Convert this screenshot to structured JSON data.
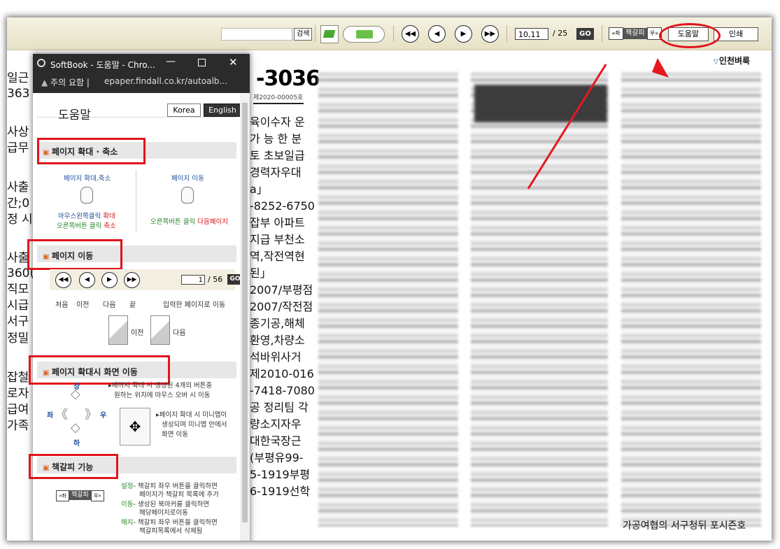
{
  "toolbar": {
    "search_placeholder": "",
    "search_label": "검색",
    "page_value": "10,11",
    "page_total": "/ 25",
    "go_label": "GO",
    "bookmark_left": "«좌",
    "bookmark_label": "책갈피",
    "bookmark_right": "우»",
    "help_label": "도움말",
    "print_label": "인쇄",
    "nav": [
      "◀◀",
      "◀",
      "▶",
      "▶▶"
    ]
  },
  "region_label": "인천벼룩",
  "newspaper": {
    "big_number": "-3036",
    "registration": "제2020-00005호",
    "left_fragments": [
      "일근",
      "363",
      "사상",
      "급무",
      "사출",
      "간;0",
      "정 시",
      "사출",
      "360(",
      "직모",
      "시급",
      "서구",
      "정밀",
      "잡철",
      "로자",
      "급여",
      "가족"
    ],
    "mid_lines": [
      "육이수자 운",
      "가 능 한 분",
      "토 초보일급",
      "경력자우대",
      "a」",
      "-8252-6750",
      "잡부 아파트",
      "지급 부천소",
      "역,작전역현",
      "된」",
      "2007/부평점",
      "2007/작전점",
      "종기공,해체",
      "환영,차량소",
      "석바위사거",
      "제2010-016",
      "-7418-7080",
      "공 정리팀 각",
      "량소지자우",
      "대한국장근",
      "(부평유99-",
      "5-1919부평",
      "6-1919선학"
    ],
    "bottom_right": "가공여협의 서구청뒤 포시즌호"
  },
  "popup": {
    "window_title": "SoftBook - 도움말 - Chro...",
    "warning_text": "주의 요함",
    "url": "epaper.findall.co.kr/autoalb...",
    "help_title": "도움말",
    "lang_korea": "Korea",
    "lang_english": "English",
    "sections": {
      "zoom": {
        "title": "페이지 확대 · 축소",
        "zoom_label": "페이지 확대,축소",
        "move_label": "페이지 이동",
        "left_click": "마우스왼쪽클릭",
        "zoom_in": "확대",
        "right_click": "오른쪽버튼 클릭",
        "zoom_out": "축소",
        "right_click2": "오른쪽버튼 클릭",
        "next_page": "다음페이지"
      },
      "nav": {
        "title": "페이지 이동",
        "page_value": "1",
        "page_total": "/ 56",
        "go": "GO",
        "labels": [
          "처음",
          "이전",
          "다음",
          "끝"
        ],
        "input_hint": "입력한 페이지로 이동",
        "prev": "이전",
        "next": "다음"
      },
      "zoom_move": {
        "title": "페이지 확대시 화면 이동",
        "desc1a": "▸페이지 확대 시 생성된 4개의 버튼중",
        "desc1b": "원하는 위치에 마우스 오버 시 이동",
        "desc2a": "▸페이지 확대 시 미니맵이",
        "desc2b": "생성되며 미니맵 안에서",
        "desc2c": "화면 이동",
        "up": "상",
        "left": "좌",
        "right": "우",
        "down": "하"
      },
      "bookmark": {
        "title": "책갈피 기능",
        "set_key": "설정",
        "set_a": "- 책갈피 좌우 버튼을 클릭하면",
        "set_b": "페이지가 책갈피 목록에 추가",
        "move_key": "이동",
        "move_a": "- 생성된 북마커를 클릭하면",
        "move_b": "해당페이지로이동",
        "del_key": "해지",
        "del_a": "- 책갈피 좌우 버튼을 클릭하면",
        "del_b": "책갈피목록에서 삭제됨",
        "sample_left": "«좌",
        "sample_label": "책갈피",
        "sample_right": "우»"
      }
    }
  },
  "colors": {
    "annotation_red": "#e0141c",
    "toolbar_bg": "#ede8d0",
    "popup_titlebar": "#2b2b2b"
  }
}
